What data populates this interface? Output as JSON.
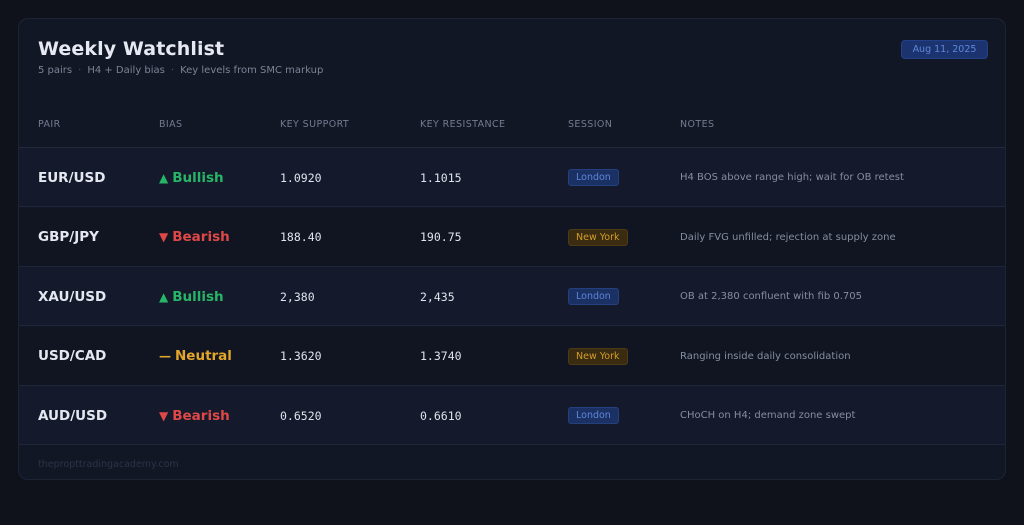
{
  "header": {
    "title": "Weekly Watchlist",
    "subtitle_parts": [
      "5 pairs",
      "H4 + Daily bias",
      "Key levels from SMC markup"
    ],
    "separator": "·",
    "date": "Aug 11, 2025"
  },
  "columns": [
    "PAIR",
    "BIAS",
    "KEY SUPPORT",
    "KEY RESISTANCE",
    "SESSION",
    "NOTES"
  ],
  "rows": [
    {
      "pair": "EUR/USD",
      "bias_icon": "▲",
      "bias": "Bullish",
      "bias_type": "bullish",
      "support": "1.0920",
      "resistance": "1.1015",
      "session": "London",
      "session_type": "london",
      "notes": "H4 BOS above range high; wait for OB retest"
    },
    {
      "pair": "GBP/JPY",
      "bias_icon": "▼",
      "bias": "Bearish",
      "bias_type": "bearish",
      "support": "188.40",
      "resistance": "190.75",
      "session": "New York",
      "session_type": "ny",
      "notes": "Daily FVG unfilled; rejection at supply zone"
    },
    {
      "pair": "XAU/USD",
      "bias_icon": "▲",
      "bias": "Bullish",
      "bias_type": "bullish",
      "support": "2,380",
      "resistance": "2,435",
      "session": "London",
      "session_type": "london",
      "notes": "OB at 2,380 confluent with fib 0.705"
    },
    {
      "pair": "USD/CAD",
      "bias_icon": "—",
      "bias": "Neutral",
      "bias_type": "neutral",
      "support": "1.3620",
      "resistance": "1.3740",
      "session": "New York",
      "session_type": "ny",
      "notes": "Ranging inside daily consolidation"
    },
    {
      "pair": "AUD/USD",
      "bias_icon": "▼",
      "bias": "Bearish",
      "bias_type": "bearish",
      "support": "0.6520",
      "resistance": "0.6610",
      "session": "London",
      "session_type": "london",
      "notes": "CHoCH on H4; demand zone swept"
    }
  ],
  "footer": "thepropttradingacademy.com",
  "colors": {
    "background": "#0f121b",
    "card": "#121726",
    "bullish": "#27b567",
    "bearish": "#e04848",
    "neutral": "#e3a52a",
    "london_badge": "#1b3063",
    "ny_badge": "#3a2c10"
  }
}
